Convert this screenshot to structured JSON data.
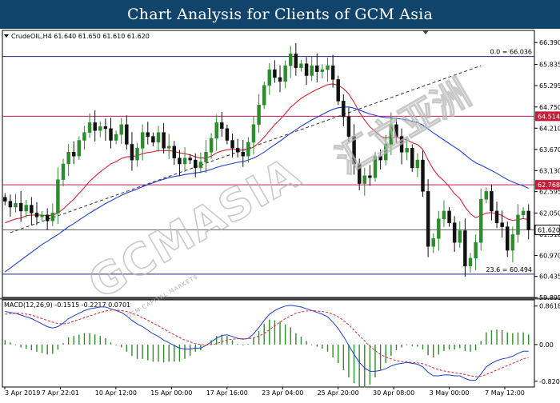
{
  "header": {
    "title": "Chart Analysis for Clients of GCM Asia"
  },
  "symbol_info": "CrudeOIL,H4  61.640 61.650 61.610 61.620",
  "macd_label": "MACD(12,26,9) -0.1515 -0.2217 0.0701",
  "watermark": {
    "main": "GCMASIA",
    "sub": "GCM CAPITAL MARKETS",
    "chinese": "汇立亚洲"
  },
  "colors": {
    "header_bg": "#11446a",
    "bull_candle": "#2e8b2e",
    "bear_candle": "#111111",
    "ma_fast": "#d62735",
    "ma_slow": "#1f3fd6",
    "support_line": "#1a237e",
    "resistance_line": "#c2185b",
    "macd_hist": "#2e8b2e",
    "macd_main": "#1f3fd6",
    "macd_signal": "#d62735",
    "resistance_tag": "#c41e3a",
    "price_tag": "#ffffff"
  },
  "chart_data": [
    {
      "type": "candlestick",
      "title": "CrudeOIL,H4",
      "ylim": [
        59.9,
        66.7
      ],
      "y_ticks": [
        66.39,
        65.835,
        65.295,
        64.75,
        64.21,
        63.67,
        63.13,
        62.595,
        62.05,
        61.51,
        60.97,
        60.435,
        59.895
      ],
      "x_ticks": [
        "3 Apr 2019",
        "7 Apr 22:01",
        "10 Apr 12:00",
        "15 Apr 00:00",
        "17 Apr 16:00",
        "23 Apr 04:00",
        "25 Apr 20:00",
        "30 Apr 08:00",
        "3 May 00:00",
        "7 May 12:00"
      ],
      "last_price": 61.62,
      "last_price_label": "61.620",
      "levels": [
        {
          "name": "fib-0",
          "value": 66.036,
          "label": "0.0 = 66.036",
          "kind": "support"
        },
        {
          "name": "resistance-high",
          "value": 64.514,
          "label": "64.514",
          "kind": "resistance"
        },
        {
          "name": "resistance-mid",
          "value": 62.768,
          "label": "62.768",
          "kind": "resistance"
        },
        {
          "name": "fib-23",
          "value": 60.494,
          "label": "23.6 = 60.494",
          "kind": "support"
        }
      ],
      "trendline": {
        "from": [
          1,
          61.55
        ],
        "to": [
          90,
          65.8
        ]
      },
      "series": [
        {
          "name": "close",
          "values": [
            62.35,
            62.2,
            62.3,
            62.1,
            62.25,
            62.05,
            61.95,
            62.0,
            61.85,
            62.05,
            62.9,
            63.3,
            63.6,
            63.5,
            63.9,
            64.1,
            64.35,
            64.15,
            64.25,
            64.2,
            63.9,
            64.05,
            64.3,
            63.8,
            63.4,
            63.7,
            64.1,
            64.0,
            63.85,
            64.1,
            63.7,
            63.75,
            63.45,
            63.3,
            63.45,
            63.4,
            63.2,
            63.35,
            63.6,
            63.95,
            64.35,
            64.2,
            63.9,
            63.7,
            63.6,
            63.5,
            63.85,
            64.3,
            64.8,
            65.3,
            65.7,
            65.5,
            65.4,
            65.8,
            66.1,
            65.75,
            65.85,
            65.55,
            65.8,
            65.65,
            65.7,
            65.8,
            65.45,
            64.9,
            64.5,
            64.0,
            63.3,
            62.8,
            63.0,
            62.95,
            63.5,
            63.4,
            63.8,
            64.3,
            64.0,
            63.6,
            63.7,
            63.2,
            63.4,
            62.6,
            61.2,
            61.4,
            61.9,
            62.1,
            61.8,
            61.3,
            61.6,
            60.7,
            60.9,
            61.3,
            62.4,
            62.6,
            62.1,
            61.8,
            61.7,
            61.1,
            61.5,
            62.0,
            62.1,
            61.62
          ]
        },
        {
          "name": "MA fast",
          "values": [
            61.8,
            61.85,
            61.9,
            61.92,
            61.98,
            62.0,
            62.0,
            62.0,
            61.98,
            61.99,
            62.05,
            62.15,
            62.28,
            62.4,
            62.55,
            62.7,
            62.86,
            62.98,
            63.1,
            63.2,
            63.3,
            63.36,
            63.44,
            63.48,
            63.49,
            63.51,
            63.56,
            63.59,
            63.61,
            63.64,
            63.64,
            63.64,
            63.62,
            63.58,
            63.56,
            63.53,
            63.48,
            63.45,
            63.45,
            63.5,
            63.58,
            63.63,
            63.66,
            63.67,
            63.66,
            63.65,
            63.67,
            63.73,
            63.84,
            63.98,
            64.14,
            64.3,
            64.43,
            64.58,
            64.74,
            64.86,
            64.97,
            65.05,
            65.13,
            65.2,
            65.26,
            65.32,
            65.34,
            65.3,
            65.22,
            65.08,
            64.87,
            64.62,
            64.42,
            64.24,
            64.13,
            64.01,
            63.96,
            63.98,
            63.98,
            63.94,
            63.91,
            63.84,
            63.79,
            63.67,
            63.4,
            63.16,
            62.99,
            62.87,
            62.72,
            62.54,
            62.42,
            62.2,
            62.03,
            61.93,
            61.98,
            62.05,
            62.06,
            62.03,
            61.99,
            61.9,
            61.86,
            61.88,
            61.91,
            61.88
          ]
        },
        {
          "name": "MA slow",
          "values": [
            60.55,
            60.65,
            60.75,
            60.85,
            60.95,
            61.05,
            61.15,
            61.25,
            61.33,
            61.42,
            61.5,
            61.6,
            61.7,
            61.78,
            61.87,
            61.96,
            62.05,
            62.13,
            62.21,
            62.29,
            62.36,
            62.43,
            62.5,
            62.56,
            62.61,
            62.66,
            62.72,
            62.77,
            62.82,
            62.87,
            62.91,
            62.95,
            62.98,
            63.0,
            63.03,
            63.05,
            63.07,
            63.09,
            63.12,
            63.16,
            63.21,
            63.25,
            63.28,
            63.31,
            63.34,
            63.36,
            63.4,
            63.45,
            63.52,
            63.6,
            63.7,
            63.79,
            63.88,
            63.98,
            64.08,
            64.17,
            64.26,
            64.34,
            64.42,
            64.49,
            64.56,
            64.63,
            64.69,
            64.73,
            64.75,
            64.75,
            64.72,
            64.67,
            64.62,
            64.57,
            64.54,
            64.5,
            64.48,
            64.47,
            64.46,
            64.44,
            64.42,
            64.39,
            64.35,
            64.29,
            64.19,
            64.09,
            64.0,
            63.91,
            63.82,
            63.73,
            63.64,
            63.53,
            63.42,
            63.33,
            63.27,
            63.2,
            63.13,
            63.06,
            62.98,
            62.9,
            62.84,
            62.79,
            62.74,
            62.68
          ]
        }
      ]
    },
    {
      "type": "bar",
      "title": "MACD(12,26,9)",
      "ylim": [
        -0.95,
        1.0
      ],
      "y_ticks": [
        0.8618,
        0.0,
        -0.8204
      ],
      "series": [
        {
          "name": "MACD",
          "values": [
            0.74,
            0.72,
            0.7,
            0.66,
            0.62,
            0.58,
            0.52,
            0.46,
            0.4,
            0.37,
            0.4,
            0.48,
            0.58,
            0.64,
            0.7,
            0.76,
            0.8,
            0.82,
            0.84,
            0.84,
            0.8,
            0.76,
            0.72,
            0.64,
            0.54,
            0.46,
            0.4,
            0.32,
            0.24,
            0.18,
            0.1,
            0.04,
            -0.02,
            -0.08,
            -0.1,
            -0.1,
            -0.08,
            -0.08,
            -0.02,
            0.06,
            0.14,
            0.2,
            0.22,
            0.18,
            0.14,
            0.12,
            0.14,
            0.24,
            0.38,
            0.54,
            0.68,
            0.76,
            0.82,
            0.86,
            0.88,
            0.86,
            0.84,
            0.8,
            0.76,
            0.72,
            0.68,
            0.62,
            0.5,
            0.36,
            0.18,
            -0.02,
            -0.22,
            -0.4,
            -0.52,
            -0.6,
            -0.6,
            -0.58,
            -0.54,
            -0.48,
            -0.44,
            -0.42,
            -0.4,
            -0.42,
            -0.44,
            -0.5,
            -0.62,
            -0.7,
            -0.7,
            -0.68,
            -0.68,
            -0.7,
            -0.7,
            -0.76,
            -0.8,
            -0.8,
            -0.66,
            -0.5,
            -0.42,
            -0.36,
            -0.32,
            -0.3,
            -0.26,
            -0.2,
            -0.15,
            -0.15
          ]
        },
        {
          "name": "Signal",
          "values": [
            0.68,
            0.69,
            0.7,
            0.7,
            0.68,
            0.66,
            0.62,
            0.58,
            0.54,
            0.5,
            0.47,
            0.46,
            0.48,
            0.52,
            0.56,
            0.6,
            0.64,
            0.68,
            0.72,
            0.75,
            0.77,
            0.77,
            0.76,
            0.74,
            0.7,
            0.66,
            0.6,
            0.54,
            0.48,
            0.42,
            0.35,
            0.28,
            0.22,
            0.16,
            0.1,
            0.06,
            0.02,
            0.0,
            -0.01,
            0.0,
            0.02,
            0.06,
            0.1,
            0.12,
            0.13,
            0.13,
            0.13,
            0.15,
            0.19,
            0.25,
            0.33,
            0.42,
            0.5,
            0.58,
            0.64,
            0.7,
            0.73,
            0.75,
            0.76,
            0.75,
            0.74,
            0.72,
            0.68,
            0.62,
            0.54,
            0.44,
            0.32,
            0.2,
            0.08,
            -0.04,
            -0.14,
            -0.22,
            -0.28,
            -0.32,
            -0.36,
            -0.38,
            -0.39,
            -0.4,
            -0.41,
            -0.43,
            -0.47,
            -0.52,
            -0.56,
            -0.59,
            -0.61,
            -0.63,
            -0.65,
            -0.67,
            -0.7,
            -0.72,
            -0.71,
            -0.67,
            -0.62,
            -0.57,
            -0.52,
            -0.47,
            -0.42,
            -0.37,
            -0.32,
            -0.29
          ]
        }
      ]
    }
  ]
}
